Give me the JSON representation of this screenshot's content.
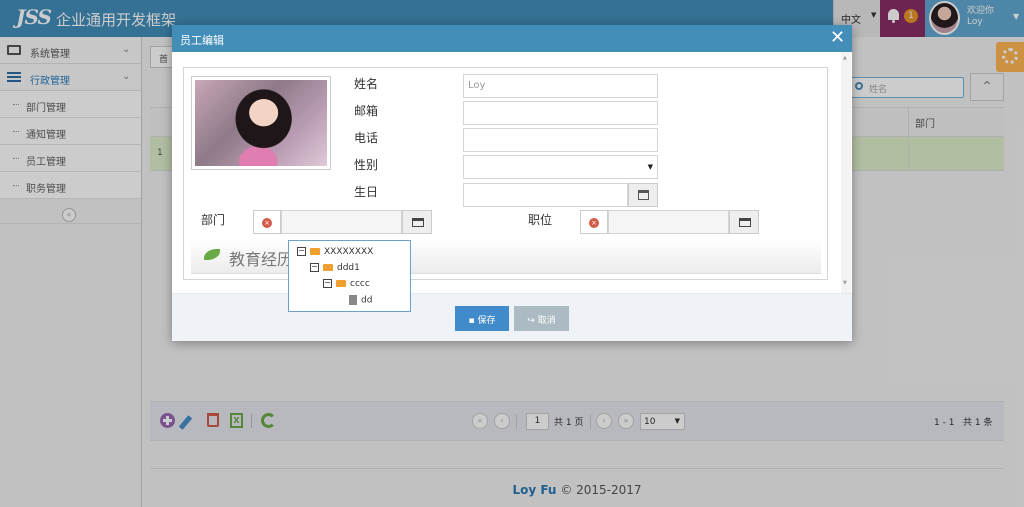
{
  "header": {
    "logo": "JSS",
    "app_title": "企业通用开发框架",
    "language": "中文",
    "notification_count": "1",
    "welcome_label": "欢迎你",
    "username": "Loy"
  },
  "sidebar": {
    "items": [
      {
        "label": "系统管理",
        "icon": "monitor-icon"
      },
      {
        "label": "行政管理",
        "icon": "list-icon"
      }
    ],
    "sub_items": [
      "部门管理",
      "通知管理",
      "员工管理",
      "职务管理"
    ]
  },
  "main": {
    "first_tab": "首",
    "search_placeholder": "姓名",
    "grid_column": "部门",
    "row_number": "1"
  },
  "pager": {
    "current_page": "1",
    "total_pages_text": "共 1 页",
    "page_size": "10",
    "record_range": "1 - 1",
    "record_total": "共 1 条"
  },
  "footer": {
    "author": "Loy Fu",
    "copyright": "© 2015-2017"
  },
  "modal": {
    "title": "员工编辑",
    "fields": {
      "name_label": "姓名",
      "name_value": "Loy",
      "email_label": "邮箱",
      "phone_label": "电话",
      "gender_label": "性别",
      "birthday_label": "生日",
      "dept_label": "部门",
      "position_label": "职位"
    },
    "education_label": "教育经历",
    "tree": [
      {
        "label": "XXXXXXXX",
        "type": "folder",
        "expanded": true
      },
      {
        "label": "ddd1",
        "type": "folder",
        "expanded": true
      },
      {
        "label": "cccc",
        "type": "folder",
        "expanded": true
      },
      {
        "label": "dd",
        "type": "file"
      }
    ],
    "save_label": "保存",
    "cancel_label": "取消"
  },
  "colors": {
    "header_blue": "#438eb9",
    "bell_bg": "#892e65",
    "user_bg": "#62a8d1",
    "primary_button": "#428bca",
    "selected_row": "#dfeecb"
  }
}
